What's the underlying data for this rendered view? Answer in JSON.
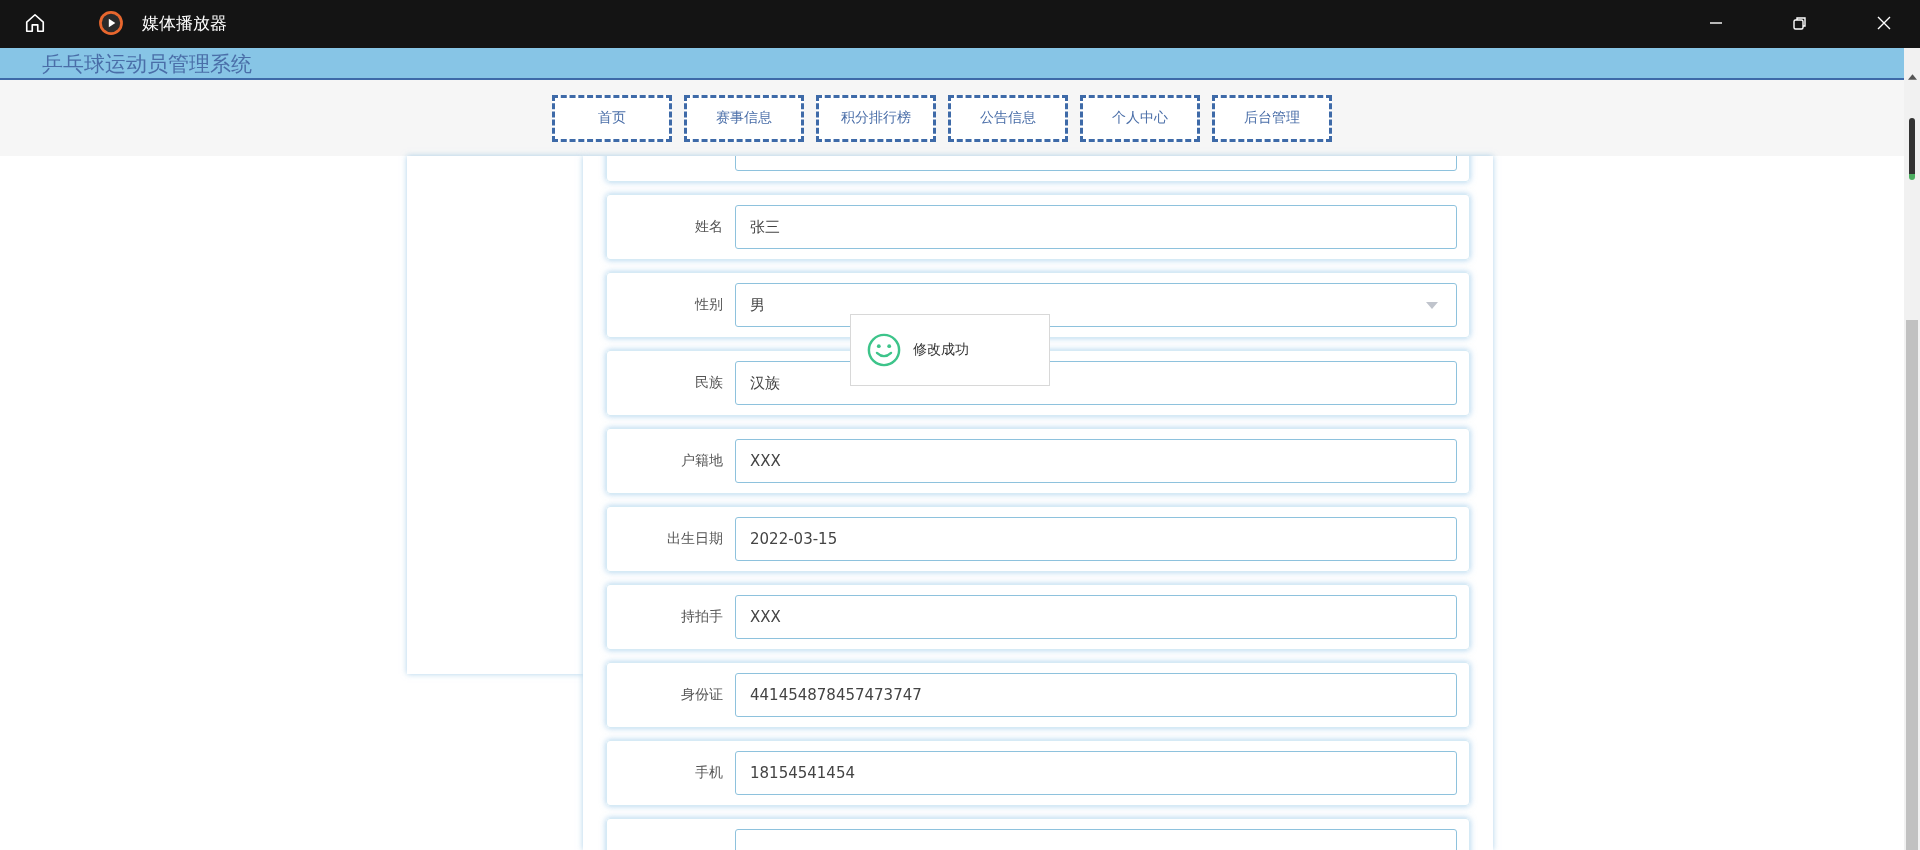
{
  "window": {
    "title": "媒体播放器"
  },
  "site": {
    "title": "乒乓球运动员管理系统"
  },
  "nav": [
    {
      "label": "首页"
    },
    {
      "label": "赛事信息"
    },
    {
      "label": "积分排行榜"
    },
    {
      "label": "公告信息"
    },
    {
      "label": "个人中心"
    },
    {
      "label": "后台管理"
    }
  ],
  "form": {
    "fields": [
      {
        "label": "姓名",
        "kind": "input",
        "value": "张三"
      },
      {
        "label": "性别",
        "kind": "select",
        "value": "男"
      },
      {
        "label": "民族",
        "kind": "input",
        "value": "汉族"
      },
      {
        "label": "户籍地",
        "kind": "input",
        "value": "XXX"
      },
      {
        "label": "出生日期",
        "kind": "input",
        "value": "2022-03-15"
      },
      {
        "label": "持拍手",
        "kind": "input",
        "value": "XXX"
      },
      {
        "label": "身份证",
        "kind": "input",
        "value": "441454878457473747"
      },
      {
        "label": "手机",
        "kind": "input",
        "value": "18154541454"
      }
    ]
  },
  "toast": {
    "message": "修改成功"
  }
}
